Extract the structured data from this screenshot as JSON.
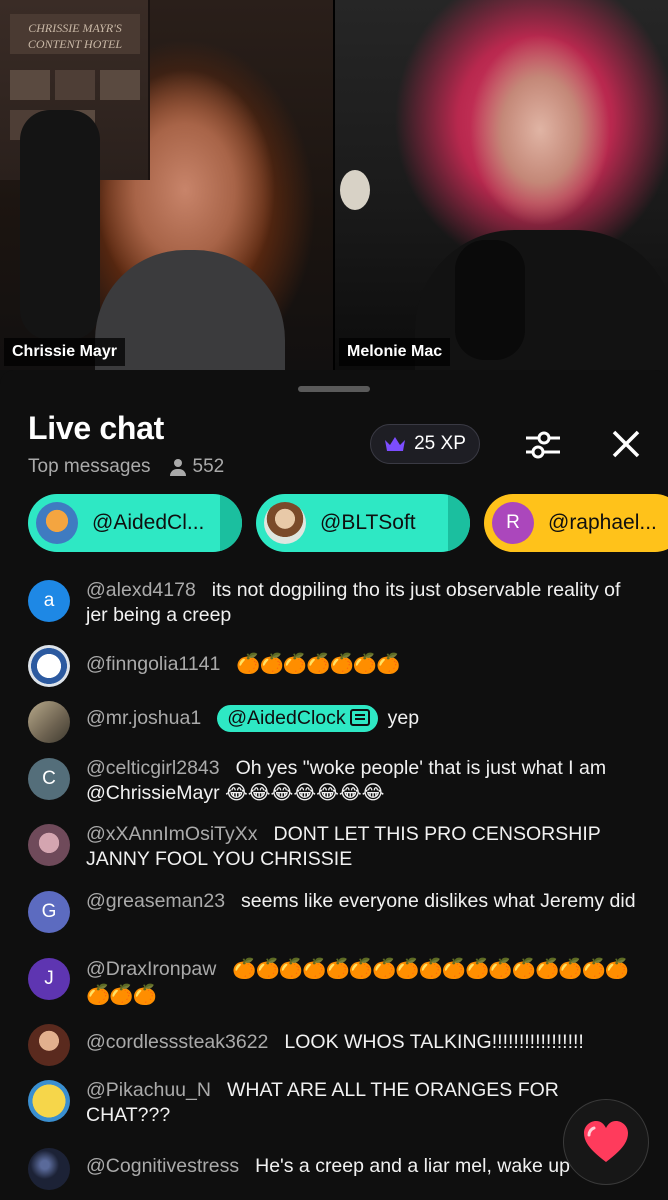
{
  "video": {
    "left_name": "Chrissie Mayr",
    "right_name": "Melonie Mac",
    "poster_text": "CHRISSIE MAYR'S CONTENT HOTEL"
  },
  "chat": {
    "title": "Live chat",
    "mode": "Top messages",
    "viewers": "552",
    "xp": "25 XP",
    "icons": {
      "filter": "filter-icon",
      "close": "close-icon",
      "viewers": "person-icon",
      "crown": "crown-icon"
    },
    "pinned": [
      {
        "name": "@AidedCl...",
        "color": "#2ee8c4"
      },
      {
        "name": "@BLTSoft",
        "color": "#2ee8c4"
      },
      {
        "name": "@raphael...",
        "color": "#ffc21a",
        "initial": "R"
      }
    ],
    "messages": [
      {
        "author": "@alexd4178",
        "initial": "a",
        "avatar_color": "#1e88e5",
        "text": "its not dogpiling tho its just observable reality of jer being a creep"
      },
      {
        "author": "@finngolia1141",
        "avatar_color": "#dde3ea",
        "text": "🍊🍊🍊🍊🍊🍊🍊"
      },
      {
        "author": "@mr.joshua1",
        "avatar_color": "#8a7f66",
        "mention": "@AidedClock",
        "text": "yep"
      },
      {
        "author": "@celticgirl2843",
        "initial": "C",
        "avatar_color": "#546e7a",
        "text": "Oh yes \"woke people' that is just what I am @ChrissieMayr 😂😂😂😂😂😂😂"
      },
      {
        "author": "@xXAnnImOsiTyXx",
        "avatar_color": "#7a5c6b",
        "text": "DONT LET THIS PRO CENSORSHIP JANNY FOOL YOU CHRISSIE"
      },
      {
        "author": "@greaseman23",
        "initial": "G",
        "avatar_color": "#5c6bc0",
        "text": "seems like everyone dislikes what Jeremy did"
      },
      {
        "author": "@DraxIronpaw",
        "initial": "J",
        "avatar_color": "#5e35b1",
        "text": "🍊🍊🍊🍊🍊🍊🍊🍊🍊🍊🍊🍊🍊🍊🍊🍊🍊🍊🍊🍊"
      },
      {
        "author": "@cordlesssteak3622",
        "avatar_color": "#8d4a3a",
        "text": "LOOK WHOS TALKING!!!!!!!!!!!!!!!!!"
      },
      {
        "author": "@Pikachuu_N",
        "avatar_color": "#f2d22e",
        "text": "WHAT ARE ALL THE ORANGES FOR CHAT???"
      },
      {
        "author": "@Cognitivestress",
        "avatar_color": "#1c2236",
        "text": "He's a creep and a liar mel, wake up"
      }
    ],
    "heart": "❤"
  }
}
